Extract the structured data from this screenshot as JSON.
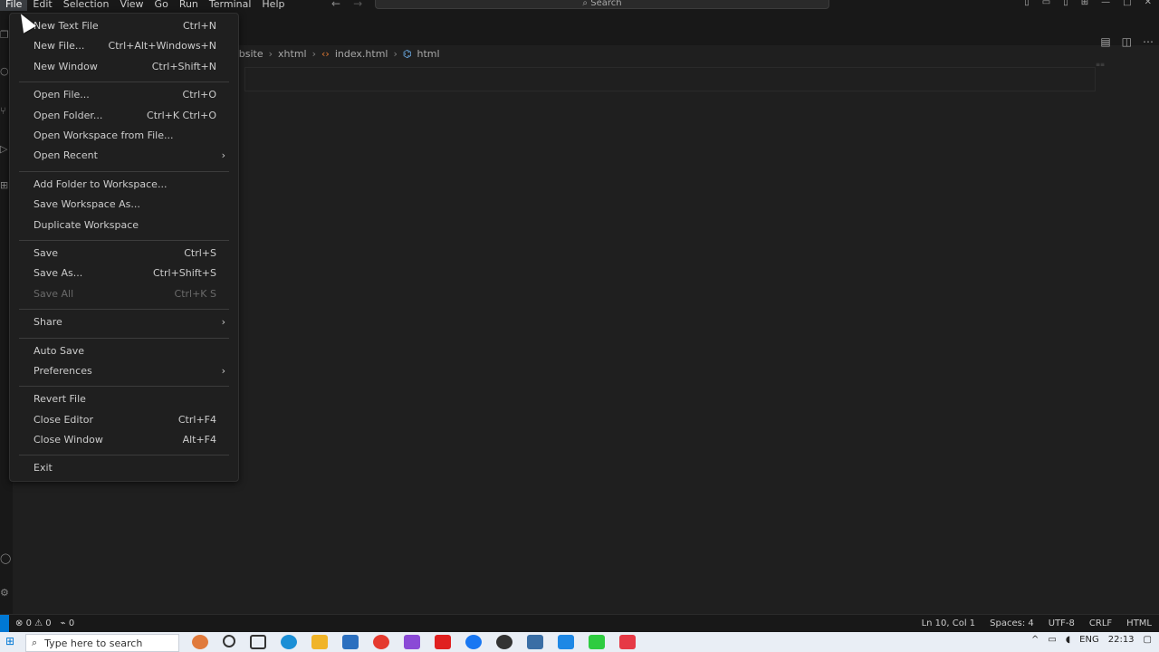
{
  "menubar": [
    "File",
    "Edit",
    "Selection",
    "View",
    "Go",
    "Run",
    "Terminal",
    "Help"
  ],
  "search_label": "Search",
  "breadcrumb": [
    "website",
    "xhtml",
    "index.html",
    "html"
  ],
  "file_menu": {
    "groups": [
      [
        {
          "label": "New Text File",
          "shortcut": "Ctrl+N"
        },
        {
          "label": "New File...",
          "shortcut": "Ctrl+Alt+Windows+N"
        },
        {
          "label": "New Window",
          "shortcut": "Ctrl+Shift+N"
        }
      ],
      [
        {
          "label": "Open File...",
          "shortcut": "Ctrl+O"
        },
        {
          "label": "Open Folder...",
          "shortcut": "Ctrl+K Ctrl+O"
        },
        {
          "label": "Open Workspace from File...",
          "shortcut": ""
        },
        {
          "label": "Open Recent",
          "shortcut": "",
          "submenu": true
        }
      ],
      [
        {
          "label": "Add Folder to Workspace...",
          "shortcut": ""
        },
        {
          "label": "Save Workspace As...",
          "shortcut": ""
        },
        {
          "label": "Duplicate Workspace",
          "shortcut": ""
        }
      ],
      [
        {
          "label": "Save",
          "shortcut": "Ctrl+S"
        },
        {
          "label": "Save As...",
          "shortcut": "Ctrl+Shift+S"
        },
        {
          "label": "Save All",
          "shortcut": "Ctrl+K S",
          "disabled": true
        }
      ],
      [
        {
          "label": "Share",
          "shortcut": "",
          "submenu": true
        }
      ],
      [
        {
          "label": "Auto Save",
          "shortcut": ""
        },
        {
          "label": "Preferences",
          "shortcut": "",
          "submenu": true
        }
      ],
      [
        {
          "label": "Revert File",
          "shortcut": ""
        },
        {
          "label": "Close Editor",
          "shortcut": "Ctrl+F4"
        },
        {
          "label": "Close Window",
          "shortcut": "Alt+F4"
        }
      ],
      [
        {
          "label": "Exit",
          "shortcut": ""
        }
      ]
    ]
  },
  "status": {
    "errors": "0",
    "warnings": "0",
    "ports": "0",
    "position": "Ln 10, Col 1",
    "spaces": "Spaces: 4",
    "encoding": "UTF-8",
    "eol": "CRLF",
    "language": "HTML"
  },
  "taskbar": {
    "search_placeholder": "Type here to search",
    "lang": "ENG",
    "time": "22:13"
  }
}
